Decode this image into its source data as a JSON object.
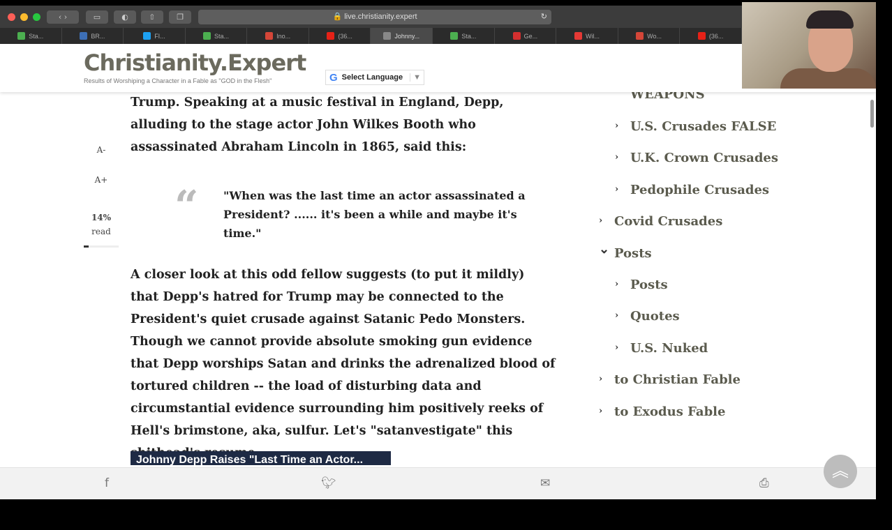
{
  "browser": {
    "url": "live.christianity.expert",
    "tabs": [
      {
        "label": "Sta...",
        "icon": "g",
        "color": "#4caf50"
      },
      {
        "label": "BR...",
        "icon": "GP",
        "color": "#3d6fb6"
      },
      {
        "label": "FI...",
        "icon": "twitter",
        "color": "#1da1f2"
      },
      {
        "label": "Sta...",
        "icon": "g",
        "color": "#4caf50"
      },
      {
        "label": "Ino...",
        "icon": "M",
        "color": "#d44638"
      },
      {
        "label": "(36...",
        "icon": "youtube",
        "color": "#e62117"
      },
      {
        "label": "Johnny...",
        "icon": "C",
        "color": "#888888",
        "active": true
      },
      {
        "label": "Sta...",
        "icon": "g",
        "color": "#4caf50"
      },
      {
        "label": "Ge...",
        "icon": "C",
        "color": "#d32f2f"
      },
      {
        "label": "Wil...",
        "icon": "W",
        "color": "#e53935"
      },
      {
        "label": "Wo...",
        "icon": "M",
        "color": "#d44638"
      },
      {
        "label": "(36...",
        "icon": "youtube",
        "color": "#e62117"
      }
    ]
  },
  "site": {
    "logo": "Christianity.Expert",
    "tagline": "Results of Worshiping a Character in a Fable as \"GOD in the Flesh\"",
    "language": "Select Language"
  },
  "rail": {
    "decrease": "A-",
    "increase": "A+",
    "percent": "14%",
    "read": "read",
    "progress": 0.14
  },
  "article": {
    "para1": "Trump. Speaking at a music festival in England, Depp, alluding to the stage actor John Wilkes Booth who assassinated Abraham Lincoln in 1865, said this:",
    "quote": "\"When was the last time an actor assassinated a President? ......  it's been a while and maybe it's time.\"",
    "para2": "A closer look at this odd fellow suggests (to put it mildly) that Depp's hatred for Trump may be connected to the President's quiet crusade against Satanic Pedo Monsters. Though we cannot provide absolute smoking gun evidence that Depp worships Satan and drinks the adrenalized blood of tortured children -- the load of disturbing data and circumstantial evidence surrounding him positively reeks of Hell's brimstone, aka, sulfur. Let's \"satanvestigate\" this shithead's resume.",
    "caption": "Johnny Depp Raises \"Last Time an Actor..."
  },
  "sidebar": {
    "partial": "WEAPONS",
    "items": [
      {
        "label": "U.S. Crusades FALSE",
        "level": 2,
        "expanded": false
      },
      {
        "label": "U.K. Crown Crusades",
        "level": 2,
        "expanded": false
      },
      {
        "label": "Pedophile Crusades",
        "level": 2,
        "expanded": false
      },
      {
        "label": "Covid Crusades",
        "level": 1,
        "expanded": false
      },
      {
        "label": "Posts",
        "level": 1,
        "expanded": true
      },
      {
        "label": "Posts",
        "level": 2,
        "expanded": false
      },
      {
        "label": "Quotes",
        "level": 2,
        "expanded": false
      },
      {
        "label": "U.S. Nuked",
        "level": 2,
        "expanded": false
      },
      {
        "label": "to Christian Fable",
        "level": 1,
        "expanded": false
      },
      {
        "label": "to Exodus Fable",
        "level": 1,
        "expanded": false
      }
    ]
  },
  "footer": {
    "icons": [
      "facebook-icon",
      "twitter-icon",
      "mail-icon",
      "print-icon"
    ]
  }
}
